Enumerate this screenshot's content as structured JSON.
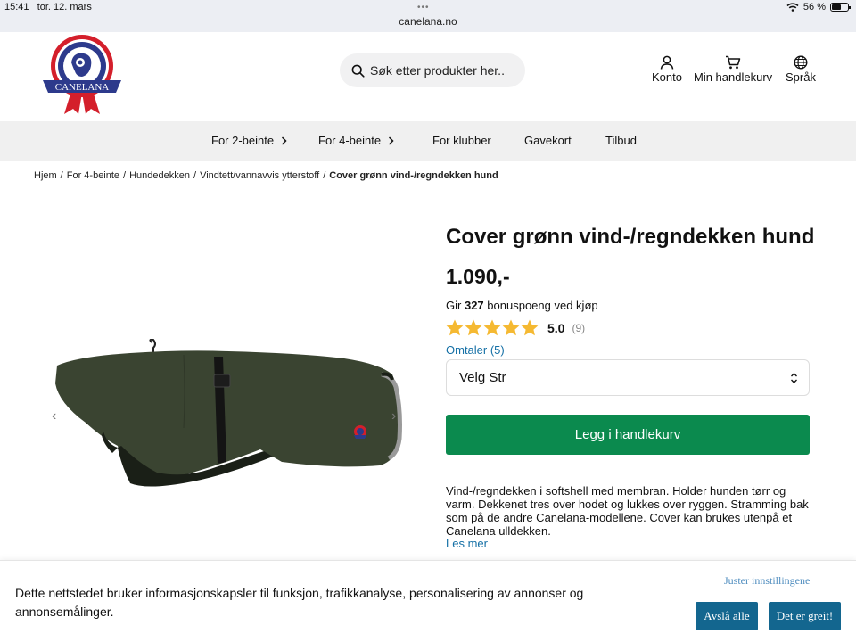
{
  "status_bar": {
    "time": "15:41",
    "date": "tor. 12. mars",
    "url": "canelana.no",
    "battery": "56 %"
  },
  "header": {
    "logo_text": "CANELANA",
    "search": {
      "placeholder": "Søk etter produkter her.."
    },
    "account_label": "Konto",
    "cart_label": "Min handlekurv",
    "language_label": "Språk"
  },
  "nav": {
    "items": [
      {
        "label": "For 2-beinte"
      },
      {
        "label": "For 4-beinte"
      },
      {
        "label": "For klubber"
      },
      {
        "label": "Gavekort"
      },
      {
        "label": "Tilbud"
      }
    ]
  },
  "breadcrumb": {
    "items": [
      "Hjem",
      "For 4-beinte",
      "Hundedekken",
      "Vindtett/vannavvis ytterstoff"
    ],
    "current": "Cover grønn vind-/regndekken hund",
    "separator": "/"
  },
  "product": {
    "title": "Cover grønn vind-/regndekken hund",
    "price": "1.090,-",
    "bonus_prefix": "Gir",
    "bonus_points": "327",
    "bonus_suffix": "bonuspoeng ved kjøp",
    "rating_value": "5.0",
    "rating_count": "(9)",
    "stars": 5,
    "reviews_link": "Omtaler (5)",
    "size_select": "Velg Str",
    "add_to_cart": "Legg i handlekurv",
    "description": "Vind-/regndekken i softshell med membran. Holder hunden tørr og varm. Dekkenet tres over hodet og lukkes over ryggen. Stramming bak som på de andre Canelana-modellene. Cover kan brukes utenpå et Canelana ulldekken.",
    "read_more": "Les mer"
  },
  "cookie": {
    "text": "Dette nettstedet bruker informasjonskapsler til funksjon, trafikkanalyse, personalisering av annonser og annonsemålinger.",
    "settings": "Juster innstillingene",
    "reject": "Avslå alle",
    "accept": "Det er greit!"
  },
  "colors": {
    "primary_button": "#0b8a4e",
    "cookie_button": "#13668f",
    "link": "#1570a6",
    "star": "#f5b932"
  }
}
